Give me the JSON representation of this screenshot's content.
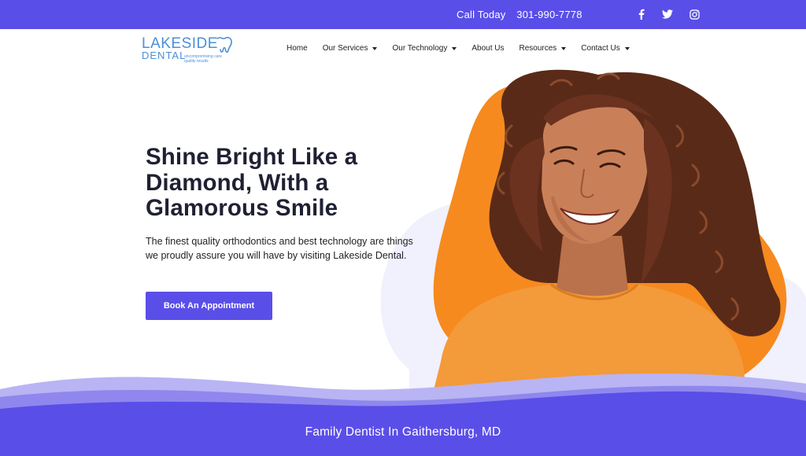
{
  "topbar": {
    "call_label": "Call Today",
    "phone": "301-990-7778",
    "social": [
      {
        "icon": "facebook-icon",
        "glyph": "f"
      },
      {
        "icon": "twitter-icon",
        "glyph": "t"
      },
      {
        "icon": "instagram-icon",
        "glyph": "i"
      }
    ]
  },
  "logo": {
    "line1": "LAKESIDE",
    "line2": "DENTAL",
    "tagline1": "uncompromising care",
    "tagline2": "quality results"
  },
  "nav": [
    {
      "label": "Home",
      "dropdown": false
    },
    {
      "label": "Our Services",
      "dropdown": true
    },
    {
      "label": "Our Technology",
      "dropdown": true
    },
    {
      "label": "About Us",
      "dropdown": false
    },
    {
      "label": "Resources",
      "dropdown": true
    },
    {
      "label": "Contact Us",
      "dropdown": true
    }
  ],
  "hero": {
    "title": "Shine Bright Like a Diamond, With a Glamorous Smile",
    "text": "The finest quality orthodontics and best technology are things we proudly assure you will have by visiting Lakeside Dental.",
    "cta_label": "Book An Appointment",
    "image_subject": "smiling woman with curly hair in orange t-shirt"
  },
  "footer_banner": {
    "text": "Family Dentist In Gaithersburg, MD"
  },
  "colors": {
    "brand": "#5a4ee8",
    "accent_orange": "#f68a1f",
    "logo_blue": "#4a8fd8",
    "text_dark": "#1f2033"
  }
}
